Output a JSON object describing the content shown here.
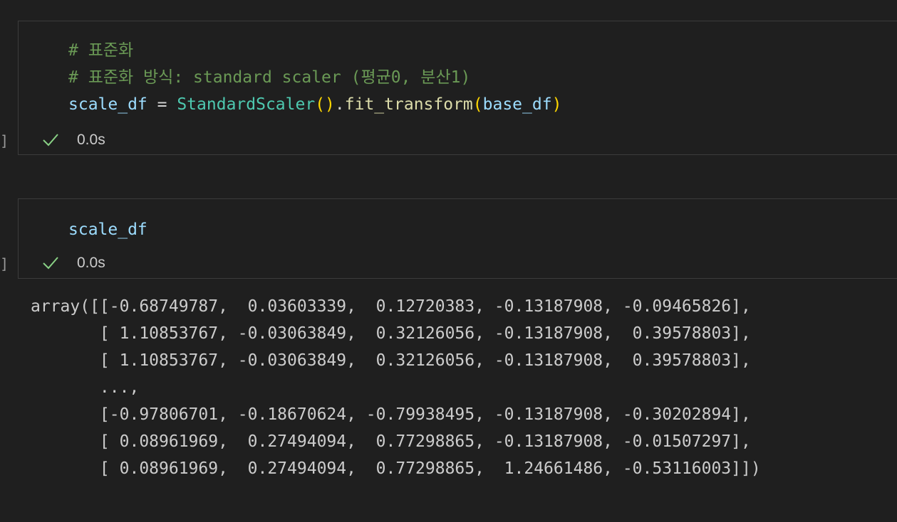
{
  "cell1": {
    "line1": "# 표준화",
    "line2": "# 표준화 방식: standard scaler (평균0, 분산1)",
    "line3": {
      "var": "scale_df",
      "eq": " = ",
      "cls": "StandardScaler",
      "p1": "()",
      "dot": ".",
      "fn": "fit_transform",
      "p2": "(",
      "arg": "base_df",
      "p3": ")"
    },
    "status": "0.0s",
    "bracket": "]"
  },
  "cell2": {
    "code": "scale_df",
    "status": "0.0s",
    "bracket": "]"
  },
  "output": {
    "lines": [
      "array([[-0.68749787,  0.03603339,  0.12720383, -0.13187908, -0.09465826],",
      "       [ 1.10853767, -0.03063849,  0.32126056, -0.13187908,  0.39578803],",
      "       [ 1.10853767, -0.03063849,  0.32126056, -0.13187908,  0.39578803],",
      "       ...,",
      "       [-0.97806701, -0.18670624, -0.79938495, -0.13187908, -0.30202894],",
      "       [ 0.08961969,  0.27494094,  0.77298865, -0.13187908, -0.01507297],",
      "       [ 0.08961969,  0.27494094,  0.77298865,  1.24661486, -0.53116003]])"
    ]
  },
  "icons": {
    "check": "check-icon"
  },
  "colors": {
    "background": "#1f1f1f",
    "comment": "#6a9955",
    "variable": "#9cdcfe",
    "class": "#4ec9b0",
    "function": "#dcdcaa",
    "check": "#89d185"
  }
}
